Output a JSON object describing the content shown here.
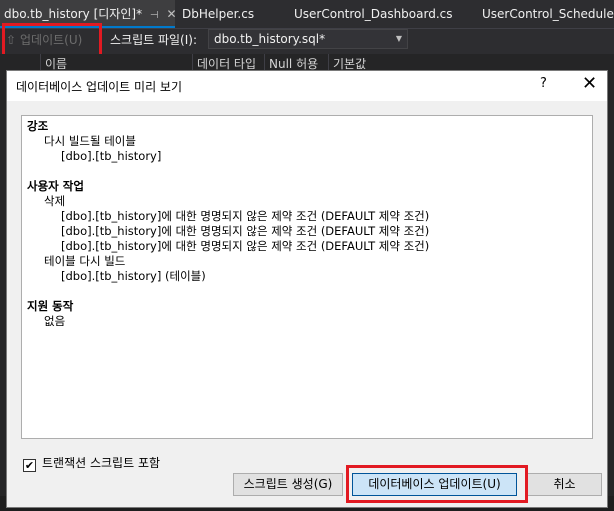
{
  "tabs": [
    {
      "label": "dbo.tb_history [디자인]*",
      "active": true
    },
    {
      "label": "DbHelper.cs",
      "active": false
    },
    {
      "label": "UserControl_Dashboard.cs",
      "active": false
    },
    {
      "label": "UserControl_ScheduleMg",
      "active": false
    }
  ],
  "toolbar": {
    "update_label": "업데이트(U)",
    "script_file_label": "스크립트 파일(I):",
    "script_file_value": "dbo.tb_history.sql*"
  },
  "grid": {
    "columns": [
      "이름",
      "데이터 타입",
      "Null 허용",
      "기본값"
    ]
  },
  "dialog": {
    "title": "데이터베이스 업데이트 미리 보기",
    "help": "?",
    "close": "✕",
    "preview": {
      "highlights_title": "강조",
      "highlights_item": "다시 빌드될 테이블",
      "highlights_table": "[dbo].[tb_history]",
      "user_actions_title": "사용자 작업",
      "delete_label": "삭제",
      "constraints": [
        "[dbo].[tb_history]에 대한 명명되지 않은 제약 조건 (DEFAULT 제약 조건)",
        "[dbo].[tb_history]에 대한 명명되지 않은 제약 조건 (DEFAULT 제약 조건)",
        "[dbo].[tb_history]에 대한 명명되지 않은 제약 조건 (DEFAULT 제약 조건)"
      ],
      "rebuild_label": "테이블 다시 빌드",
      "rebuild_table": "[dbo].[tb_history] (테이블)",
      "supporting_title": "지원 동작",
      "supporting_none": "없음"
    },
    "include_transaction_label": "트랜잭션 스크립트 포함",
    "include_transaction_checked": true,
    "generate_script_button": "스크립트 생성(G)",
    "update_database_button": "데이터베이스 업데이트(U)",
    "cancel_button": "취소"
  },
  "colors": {
    "highlight": "#e21a22",
    "ide_background": "#252526",
    "dialog_background": "#f0f0f0"
  }
}
